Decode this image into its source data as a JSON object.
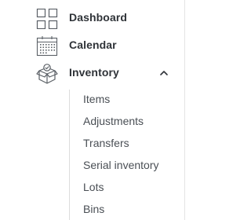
{
  "nav": {
    "items": [
      {
        "label": "Dashboard",
        "icon": "grid-icon"
      },
      {
        "label": "Calendar",
        "icon": "calendar-icon"
      },
      {
        "label": "Inventory",
        "icon": "box-icon",
        "expanded": true,
        "toggle_icon": "chevron-up-icon"
      }
    ],
    "inventory_subitems": [
      {
        "label": "Items"
      },
      {
        "label": "Adjustments"
      },
      {
        "label": "Transfers"
      },
      {
        "label": "Serial inventory"
      },
      {
        "label": "Lots"
      },
      {
        "label": "Bins"
      }
    ]
  },
  "colors": {
    "icon_stroke": "#5b6066",
    "label": "#2f3338",
    "sub_label": "#4a4f55",
    "divider": "#e4e4e4"
  }
}
